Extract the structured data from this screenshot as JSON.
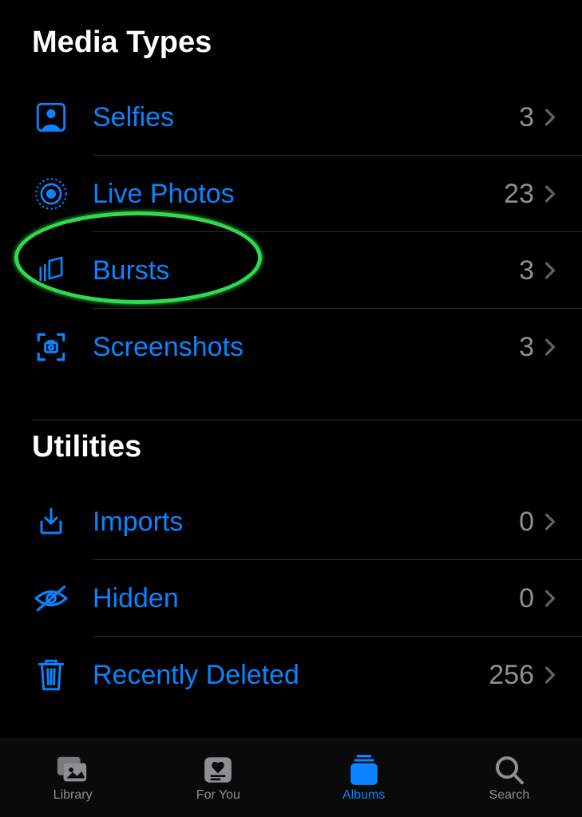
{
  "sections": {
    "media_types": {
      "title": "Media Types",
      "items": [
        {
          "label": "Selfies",
          "count": "3",
          "icon": "selfies"
        },
        {
          "label": "Live Photos",
          "count": "23",
          "icon": "live-photos"
        },
        {
          "label": "Bursts",
          "count": "3",
          "icon": "bursts"
        },
        {
          "label": "Screenshots",
          "count": "3",
          "icon": "screenshots"
        }
      ]
    },
    "utilities": {
      "title": "Utilities",
      "items": [
        {
          "label": "Imports",
          "count": "0",
          "icon": "imports"
        },
        {
          "label": "Hidden",
          "count": "0",
          "icon": "hidden"
        },
        {
          "label": "Recently Deleted",
          "count": "256",
          "icon": "recently-deleted"
        }
      ]
    }
  },
  "tabs": {
    "library": "Library",
    "for_you": "For You",
    "albums": "Albums",
    "search": "Search"
  },
  "highlight": {
    "target": "bursts"
  }
}
